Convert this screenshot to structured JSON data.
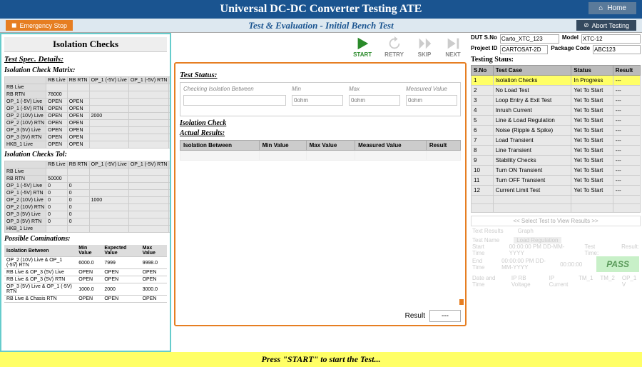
{
  "header": {
    "title": "Universal DC-DC Converter Testing ATE",
    "home": "Home",
    "subtitle": "Test & Evaluation - Initial Bench Test",
    "emergency": "Emergency Stop",
    "abort": "Abort Testing"
  },
  "section_title": "Isolation Checks",
  "spec": {
    "details_header": "Test Spec. Details:",
    "matrix_header": "Isolation Check Matrix:",
    "matrix_cols": [
      "RB Live",
      "RB RTN",
      "OP_1 (-5V) Live",
      "OP_1 (-5V) RTN"
    ],
    "matrix_rows": [
      {
        "label": "RB Live",
        "cells": [
          "",
          "",
          "",
          ""
        ]
      },
      {
        "label": "RB RTN",
        "cells": [
          "78000",
          "",
          "",
          ""
        ]
      },
      {
        "label": "OP_1 (-5V) Live",
        "cells": [
          "OPEN",
          "OPEN",
          "",
          ""
        ]
      },
      {
        "label": "OP_1 (-5V) RTN",
        "cells": [
          "OPEN",
          "OPEN",
          "",
          ""
        ]
      },
      {
        "label": "OP_2 (10V) Live",
        "cells": [
          "OPEN",
          "OPEN",
          "2000",
          ""
        ]
      },
      {
        "label": "OP_2 (10V) RTN",
        "cells": [
          "OPEN",
          "OPEN",
          "",
          ""
        ]
      },
      {
        "label": "OP_3 (5V) Live",
        "cells": [
          "OPEN",
          "OPEN",
          "",
          ""
        ]
      },
      {
        "label": "OP_3 (5V) RTN",
        "cells": [
          "OPEN",
          "OPEN",
          "",
          ""
        ]
      },
      {
        "label": "HKB_1 Live",
        "cells": [
          "OPEN",
          "OPEN",
          "",
          ""
        ]
      }
    ],
    "tol_header": "Isolation Checks Tol:",
    "tol_cols": [
      "RB Live",
      "RB RTN",
      "OP_1 (-5V) Live",
      "OP_1 (-5V) RTN"
    ],
    "tol_rows": [
      {
        "label": "RB Live",
        "cells": [
          "",
          "",
          "",
          ""
        ]
      },
      {
        "label": "RB RTN",
        "cells": [
          "50000",
          "",
          "",
          ""
        ]
      },
      {
        "label": "OP_1 (-5V) Live",
        "cells": [
          "0",
          "0",
          "",
          ""
        ]
      },
      {
        "label": "OP_1 (-5V) RTN",
        "cells": [
          "0",
          "0",
          "",
          ""
        ]
      },
      {
        "label": "OP_2 (10V) Live",
        "cells": [
          "0",
          "0",
          "1000",
          ""
        ]
      },
      {
        "label": "OP_2 (10V) RTN",
        "cells": [
          "0",
          "0",
          "",
          ""
        ]
      },
      {
        "label": "OP_3 (5V) Live",
        "cells": [
          "0",
          "0",
          "",
          ""
        ]
      },
      {
        "label": "OP_3 (5V) RTN",
        "cells": [
          "0",
          "0",
          "",
          ""
        ]
      },
      {
        "label": "HKB_1 Live",
        "cells": [
          "",
          "",
          "",
          ""
        ]
      }
    ],
    "comb_header": "Possible Cominations:",
    "comb_cols": [
      "Isolation Between",
      "Min Value",
      "Expected Value",
      "Max Value"
    ],
    "comb_rows": [
      [
        "OP_2 (10V) Live & OP_1 (-5V) RTN",
        "6000.0",
        "7999",
        "9998.0"
      ],
      [
        "RB Live & OP_3 (5V) Live",
        "OPEN",
        "OPEN",
        "OPEN"
      ],
      [
        "RB Live & OP_3 (5V) RTN",
        "OPEN",
        "OPEN",
        "OPEN"
      ],
      [
        "OP_3 (5V) Live & OP_1 (-5V) RTN",
        "1000.0",
        "2000",
        "3000.0"
      ],
      [
        "RB Live & Chasis RTN",
        "OPEN",
        "OPEN",
        "OPEN"
      ]
    ]
  },
  "status": {
    "header": "Test Status:",
    "actions": {
      "start": "START",
      "retry": "RETRY",
      "skip": "SKIP",
      "next": "NEXT"
    },
    "check_label": "Checking Isolation Between",
    "min_label": "Min",
    "max_label": "Max",
    "meas_label": "Measured Value",
    "min_ph": "0ohm",
    "max_ph": "0ohm",
    "meas_ph": "0ohm",
    "iso_header": "Isolation Check",
    "actual_header": "Actual Results:",
    "res_cols": [
      "Isolation Between",
      "Min Value",
      "Max Value",
      "Measured Value",
      "Result"
    ],
    "result_label": "Result",
    "result_value": "---"
  },
  "dut": {
    "sno_label": "DUT S.No",
    "sno": "Carto_XTC_123",
    "model_label": "Model",
    "model": "XTC-12",
    "proj_label": "Project ID",
    "proj": "CARTOSAT-2D",
    "pkg_label": "Package Code",
    "pkg": "ABC123"
  },
  "testing": {
    "header": "Testing Staus:",
    "cols": [
      "S.No",
      "Test Case",
      "Status",
      "Result"
    ],
    "rows": [
      {
        "n": "1",
        "name": "Isolation Checks",
        "status": "In Progress",
        "result": "---",
        "active": true
      },
      {
        "n": "2",
        "name": "No Load Test",
        "status": "Yet To Start",
        "result": "---"
      },
      {
        "n": "3",
        "name": "Loop Entry & Exit Test",
        "status": "Yet To Start",
        "result": "---"
      },
      {
        "n": "4",
        "name": "Inrush Current",
        "status": "Yet To Start",
        "result": "---"
      },
      {
        "n": "5",
        "name": "Line & Load Regulation",
        "status": "Yet To Start",
        "result": "---"
      },
      {
        "n": "6",
        "name": "Noise (Ripple & Spike)",
        "status": "Yet To Start",
        "result": "---"
      },
      {
        "n": "7",
        "name": "Load Transient",
        "status": "Yet To Start",
        "result": "---"
      },
      {
        "n": "8",
        "name": "Line Transient",
        "status": "Yet To Start",
        "result": "---"
      },
      {
        "n": "9",
        "name": "Stability Checks",
        "status": "Yet To Start",
        "result": "---"
      },
      {
        "n": "10",
        "name": "Turn ON Transient",
        "status": "Yet To Start",
        "result": "---"
      },
      {
        "n": "11",
        "name": "Turn OFF Transient",
        "status": "Yet To Start",
        "result": "---"
      },
      {
        "n": "12",
        "name": "Current Limit Test",
        "status": "Yet To Start",
        "result": "---"
      }
    ],
    "select_hdr": "<< Select Test to View Results >>",
    "ghost": {
      "tabs": [
        "Text Results",
        "Graph"
      ],
      "name_label": "Test Name",
      "name": "Load Regulation",
      "start_label": "Start Time",
      "start": "00:00:00 PM DD-MM-YYYY",
      "end_label": "End Time",
      "end": "00:00:00 PM DD-MM-YYYY",
      "test_time_label": "Test Time:",
      "test_time": "00:00:00",
      "result_label": "Result:",
      "result": "PASS",
      "cols": [
        "Date and Time",
        "IP RB Voltage",
        "IP Current",
        "TM_1",
        "TM_2",
        "OP_1 V"
      ]
    }
  },
  "footer": "Press \"START\" to start the Test..."
}
